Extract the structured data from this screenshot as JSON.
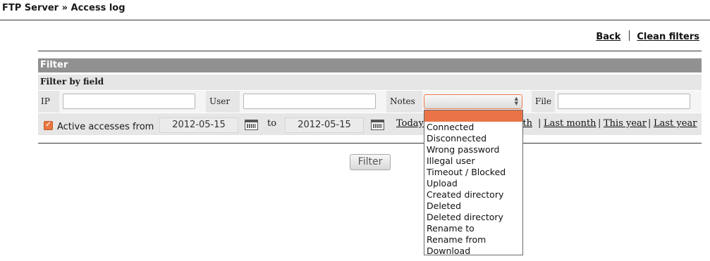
{
  "header": {
    "title": "FTP Server » Access log"
  },
  "top_links": {
    "back": "Back",
    "clean_filters": "Clean filters"
  },
  "filter": {
    "title": "Filter",
    "by_field_label": "Filter by field",
    "fields": {
      "ip": {
        "label": "IP",
        "value": ""
      },
      "user": {
        "label": "User",
        "value": ""
      },
      "notes": {
        "label": "Notes",
        "selected": ""
      },
      "file": {
        "label": "File",
        "value": ""
      }
    },
    "dates": {
      "active_checked": true,
      "active_label": "Active accesses from",
      "from": "2012-05-15",
      "to_label": "to",
      "to": "2012-05-15",
      "quick_links": [
        "Today",
        "nth",
        "Last month",
        "This year",
        "Last year"
      ]
    },
    "submit_label": "Filter"
  },
  "notes_dropdown": {
    "open": true,
    "options": [
      "",
      "Connected",
      "Disconnected",
      "Wrong password",
      "Illegal user",
      "Timeout / Blocked",
      "Upload",
      "Created directory",
      "Deleted",
      "Deleted directory",
      "Rename to",
      "Rename from",
      "Download"
    ]
  },
  "colors": {
    "accent": "#ea7447",
    "header_bg": "#919191",
    "row_bg": "#e6e6e6"
  }
}
